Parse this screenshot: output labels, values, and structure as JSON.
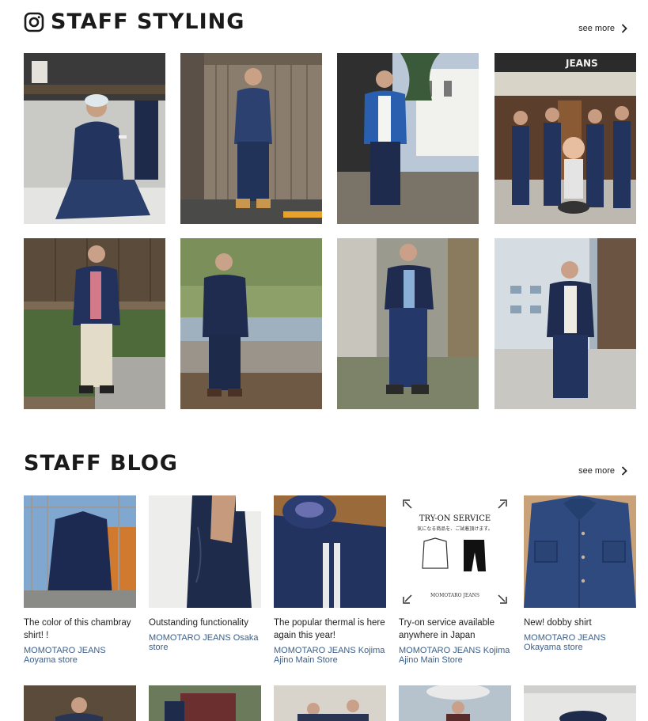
{
  "styling": {
    "title": "STAFF STYLING",
    "icon": "instagram-icon",
    "see_more": "see more"
  },
  "blog": {
    "title": "STAFF BLOG",
    "see_more": "see more",
    "posts": [
      {
        "title": "The color of this chambray shirt! !",
        "store": "MOMOTARO JEANS Aoyama store"
      },
      {
        "title": "Outstanding functionality",
        "store": "MOMOTARO JEANS Osaka store"
      },
      {
        "title": "The popular thermal is here again this year!",
        "store": "MOMOTARO JEANS Kojima Ajino Main Store"
      },
      {
        "title": "Try-on service available anywhere in Japan",
        "store": "MOMOTARO JEANS Kojima Ajino Main Store"
      },
      {
        "title": "New! dobby shirt",
        "store": "MOMOTARO JEANS Okayama store"
      }
    ]
  },
  "tryon": {
    "heading": "TRY-ON SERVICE",
    "sub": "気になる商品を、ご試着頂けます。",
    "note": "MOMOTARO JEANS"
  },
  "store_sign": "JEANS",
  "colors": {
    "link": "#3b5f8a",
    "denim": "#1f2f55"
  }
}
